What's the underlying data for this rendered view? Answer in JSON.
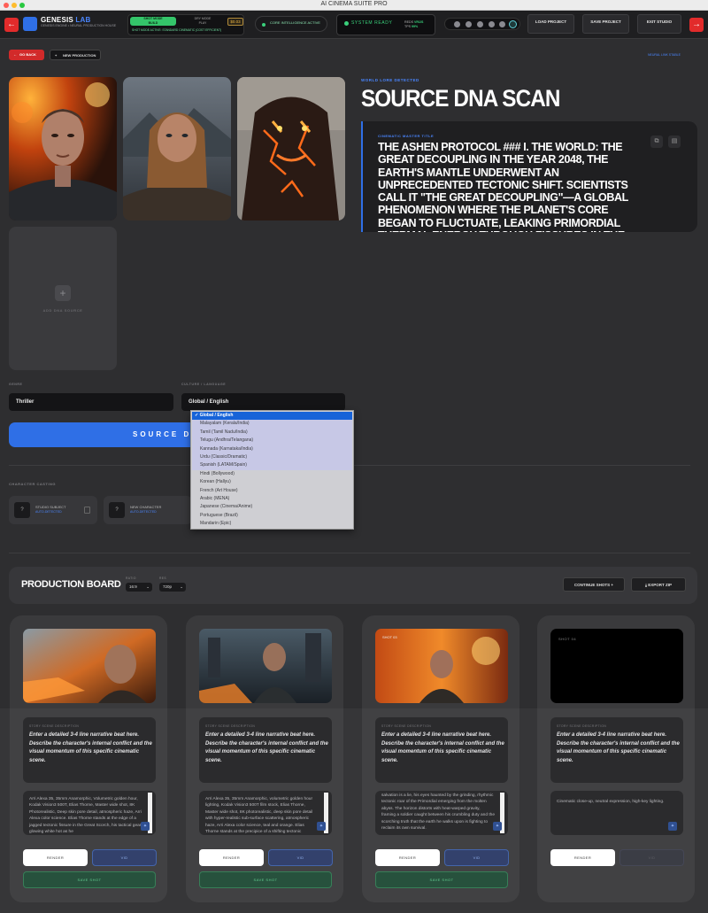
{
  "window": {
    "title": "AI CINEMA SUITE PRO"
  },
  "header": {
    "brand": {
      "name": "GENESIS",
      "name_accent": "LAB",
      "subtitle": "GENESIS ENGINE • NEURAL PRODUCTION HOUSE"
    },
    "modes": [
      {
        "label": "SHOT MODE",
        "sub": "BUILD"
      },
      {
        "label": "DRY MODE",
        "sub": "PLAY"
      }
    ],
    "price": "$0.03",
    "mode_note": "SHOT MODE ACTIVE: STANDARD CINEMATIC (COST EFFICIENT)",
    "core_status": "CORE INTELLIGENCE ACTIVE",
    "system_status": "SYSTEM READY",
    "vram": {
      "label1": "REDS",
      "val1": "VR/2S",
      "label2": "TPS",
      "val2": "99%"
    },
    "buttons": {
      "load": "LOAD PROJECT",
      "save": "SAVE PROJECT",
      "exit": "EXIT STUDIO"
    }
  },
  "toolbar": {
    "go_back": "GO BACK",
    "new_production": "NEW PRODUCTION",
    "neural_link": "NEURAL LINK STABLE"
  },
  "dna": {
    "add_label": "ADD DNA SOURCE",
    "world_lore": "WORLD LORE DETECTED",
    "title": "SOURCE DNA SCAN",
    "card_label": "CINEMATIC MASTER TITLE",
    "text": "THE ASHEN PROTOCOL ### I. THE WORLD: THE GREAT DECOUPLING IN THE YEAR 2048, THE EARTH'S MANTLE UNDERWENT AN UNPRECEDENTED TECTONIC SHIFT. SCIENTISTS CALL IT \"THE GREAT DECOUPLING\"—A GLOBAL PHENOMENON WHERE THE PLANET'S CORE BEGAN TO FLUCTUATE, LEAKING PRIMORDIAL THERMAL ENERGY THROUGH FISSURES IN THE CRUST. MAJOR CITIES WERE"
  },
  "form": {
    "genre_label": "GENRE",
    "genre_value": "Thriller",
    "culture_label": "CULTURE / LANGUAGE",
    "culture_value": "Global / English",
    "scan_button": "SOURCE DNA"
  },
  "dropdown": {
    "options": [
      "Global / English",
      "Malayalam (Kerala/India)",
      "Tamil (Tamil Nadu/India)",
      "Telugu (Andhra/Telangana)",
      "Kannada (Karnataka/India)",
      "Urdu (Classic/Dramatic)",
      "Spanish (LATAM/Spain)",
      "Hindi (Bollywood)",
      "Korean (Hallyu)",
      "French (Art House)",
      "Arabic (MENA)",
      "Japanese (Cinema/Anime)",
      "Portuguese (Brazil)",
      "Mandarin (Epic)"
    ]
  },
  "casting": {
    "label": "CHARACTER CASTING",
    "cards": [
      {
        "icon": "?",
        "title": "STUDIO SUBJECT",
        "sub": "AUTO-DETECTED"
      },
      {
        "icon": "?",
        "title": "NEW CHARACTER",
        "sub": "AUTO-DETECTED"
      }
    ]
  },
  "board": {
    "title": "PRODUCTION BOARD",
    "ratio_label": "RATIO",
    "ratio_value": "16:9",
    "res_label": "RES",
    "res_value": "720p",
    "continue": "CONTINUE SHOTS +",
    "export": "EXPORT ZIP"
  },
  "shots": [
    {
      "desc_label": "STORY SCENE DESCRIPTION",
      "desc": "Enter a detailed 3-4 line narrative beat here. Describe the character's internal conflict and the visual momentum of this specific cinematic scene.",
      "prompt": "Arri Alexa 35, 35mm Anamorphic, Volumetric golden hour, Kodak Vision3 500T, Elias Thorne, Master wide shot, 8K Photorealistic, Deep skin pore detail, atmospheric haze, Arri Alexa color science. Elias Thorne stands at the edge of a jagged tectonic fissure in the Great Scorch, his tactical gear glowing white hot as he",
      "render": "RENDER",
      "vid": "VID",
      "save": "SAVE SHOT"
    },
    {
      "desc_label": "STORY SCENE DESCRIPTION",
      "desc": "Enter a detailed 3-4 line narrative beat here. Describe the character's internal conflict and the visual momentum of this specific cinematic scene.",
      "prompt": "Arri Alexa 35, 35mm Anamorphic, volumetric golden hour lighting, Kodak Vision3 500T film stock, Elias Thorne, Master wide shot, 8K photorealistic, deep skin pore detail with hyper-realistic sub-surface scattering, atmospheric haze, Arri Alexa color science, teal and orange. Elias Thorne stands at the precipice of a shifting tectonic",
      "render": "RENDER",
      "vid": "VID",
      "save": "SAVE SHOT"
    },
    {
      "badge": "SHOT 03",
      "desc_label": "STORY SCENE DESCRIPTION",
      "desc": "Enter a detailed 3-4 line narrative beat here. Describe the character's internal conflict and the visual momentum of this specific cinematic scene.",
      "prompt": "salvation is a lie, his eyes haunted by the grinding, rhythmic tectonic roar of the Primordial emerging from the molten abyss. The horizon distorts with heat-warped gravity, framing a soldier caught between his crumbling duty and the scorching truth that the earth he walks upon is fighting to reclaim its own survival.",
      "render": "RENDER",
      "vid": "VID",
      "save": "SAVE SHOT"
    },
    {
      "badge": "SHOT 04",
      "desc_label": "STORY SCENE DESCRIPTION",
      "desc": "Enter a detailed 3-4 line narrative beat here. Describe the character's internal conflict and the visual momentum of this specific cinematic scene.",
      "prompt": "Cinematic close-up, neutral expression, high-key lighting.",
      "render": "RENDER",
      "vid": "VID"
    }
  ]
}
